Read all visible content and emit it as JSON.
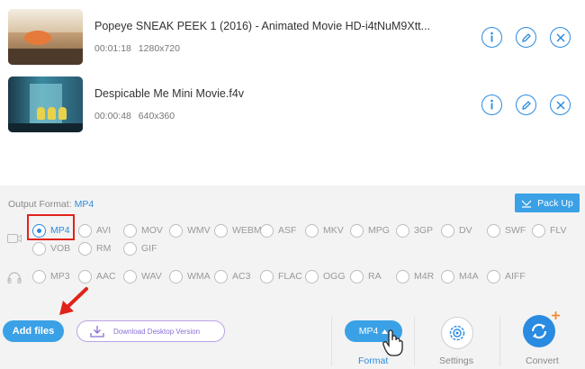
{
  "files": [
    {
      "name": "Popeye SNEAK PEEK 1 (2016) - Animated Movie HD-i4tNuM9Xtt...",
      "duration": "00:01:18",
      "resolution": "1280x720"
    },
    {
      "name": "Despicable Me Mini Movie.f4v",
      "duration": "00:00:48",
      "resolution": "640x360"
    }
  ],
  "output_format": {
    "label": "Output Format:",
    "value": "MP4"
  },
  "pack_up_label": "Pack Up",
  "video_formats": [
    "MP4",
    "AVI",
    "MOV",
    "WMV",
    "WEBM",
    "ASF",
    "MKV",
    "MPG",
    "3GP",
    "DV",
    "SWF",
    "FLV",
    "VOB",
    "RM",
    "GIF"
  ],
  "audio_formats": [
    "MP3",
    "AAC",
    "WAV",
    "WMA",
    "AC3",
    "FLAC",
    "OGG",
    "RA",
    "M4R",
    "M4A",
    "AIFF"
  ],
  "selected_format": "MP4",
  "bottom": {
    "add_files": "Add files",
    "download_desktop": "Download Desktop Version",
    "format_button": "MP4",
    "format_label": "Format",
    "settings_label": "Settings",
    "convert_label": "Convert"
  },
  "colors": {
    "accent": "#2a8be0",
    "button": "#3ba1e6",
    "highlight": "#e0241b",
    "panel": "#f3f3f3"
  },
  "icons": {
    "info": "info-icon",
    "edit": "edit-icon",
    "close": "close-icon",
    "video_category": "video-icon",
    "audio_category": "headphones-icon",
    "settings": "gear-icon",
    "convert": "convert-icon",
    "download": "download-icon",
    "arrow": "red-arrow-icon",
    "cursor": "hand-cursor-icon"
  }
}
